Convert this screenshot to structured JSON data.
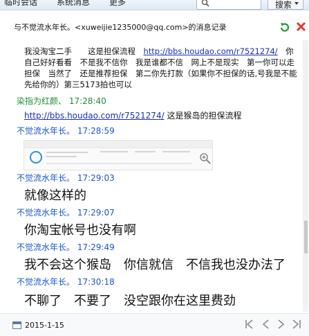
{
  "top_tabs": [
    "临时会话",
    "系统消息",
    "更多"
  ],
  "search": {
    "button_label": "搜索"
  },
  "header": {
    "title": "与不觉流水年长。<xuweijie1235000@qq.com>的消息记录"
  },
  "messages": {
    "m0": {
      "text_prefix": "我没淘宝二手　　这是担保流程　",
      "link": "http://bbs.houdao.com/r7521274/",
      "text_suffix": "　你自己好好看看　不是我不信你　我是谁都不信　网上不是现实　第一你可以走担保　当然了　还是推荐担保　第二你先打款（如果你不担保的话,号我是不能先给你的）第三5173拍也可以"
    },
    "m1": {
      "sender": "染指为红颜、",
      "time": "17:28:40",
      "link": "http://bbs.houdao.com/r7521274/",
      "text": "这是猴岛的担保流程"
    },
    "m2": {
      "sender": "不觉流水年长。",
      "time": "17:28:59"
    },
    "m3": {
      "sender": "不觉流水年长。",
      "time": "17:29:03",
      "text": "就像这样的"
    },
    "m4": {
      "sender": "不觉流水年长。",
      "time": "17:29:07",
      "text": "你淘宝帐号也没有啊"
    },
    "m5": {
      "sender": "不觉流水年长。",
      "time": "17:29:49",
      "text": "我不会这个猴岛　你信就信　不信我也没办法了"
    },
    "m6": {
      "sender": "不觉流水年长。",
      "time": "17:30:18",
      "text": "不聊了　不要了　没空跟你在这里费劲"
    }
  },
  "footer": {
    "date": "2015-1-15"
  },
  "colors": {
    "blue_sender": "#1a55c8",
    "green_sender": "#1f8a3a",
    "link": "#1a2fb0"
  }
}
